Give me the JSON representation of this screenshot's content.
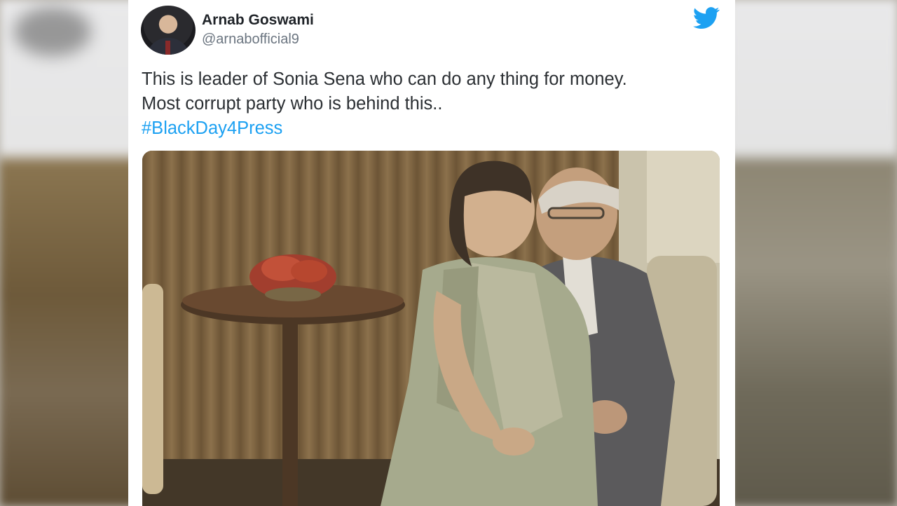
{
  "tweet": {
    "author_name": "Arnab Goswami",
    "author_handle": "@arnabofficial9",
    "text_line_1": "This is leader of Sonia Sena who can do any thing for money.",
    "text_line_2": "Most corrupt party who is behind this..",
    "hashtag": "#BlackDay4Press",
    "platform_icon": "twitter-bird-icon",
    "hashtag_color": "#1da1f2"
  }
}
